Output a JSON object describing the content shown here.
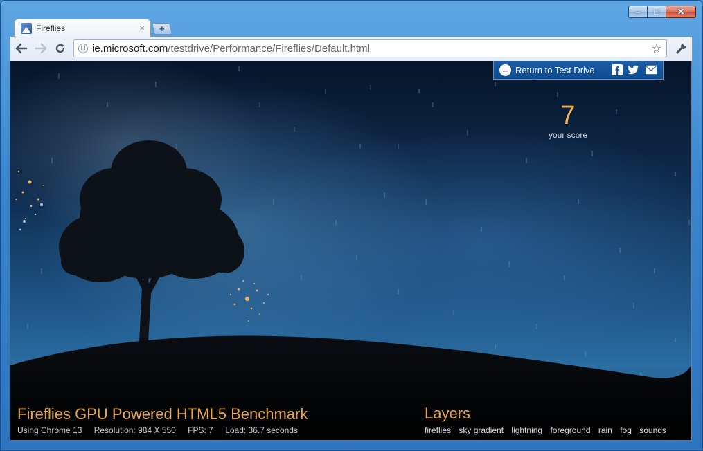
{
  "window": {
    "minimize_glyph": "‒",
    "maximize_glyph": "□",
    "close_glyph": "✕"
  },
  "tab": {
    "title": "Fireflies",
    "close_glyph": "×",
    "new_tab_glyph": "+"
  },
  "omnibox": {
    "host": "ie.microsoft.com",
    "path": "/testdrive/Performance/Fireflies/Default.html",
    "star_glyph": "☆"
  },
  "page": {
    "return_label": "Return to Test Drive",
    "return_arrow": "←",
    "social": {
      "facebook": "f",
      "twitter": "🐦",
      "email": "✉"
    },
    "score_value": "7",
    "score_label": "your score",
    "benchmark_title": "Fireflies GPU Powered HTML5 Benchmark",
    "stats": {
      "browser": "Using Chrome 13",
      "resolution": "Resolution: 984 X 550",
      "fps": "FPS: 7",
      "load": "Load: 36.7 seconds"
    },
    "layers_title": "Layers",
    "layers": [
      "fireflies",
      "sky gradient",
      "lightning",
      "foreground",
      "rain",
      "fog",
      "sounds"
    ],
    "colors": {
      "accent": "#e8a64c",
      "banner": "#1c5ea7",
      "sky_top": "#07152a",
      "sky_mid": "#1f5688"
    }
  }
}
